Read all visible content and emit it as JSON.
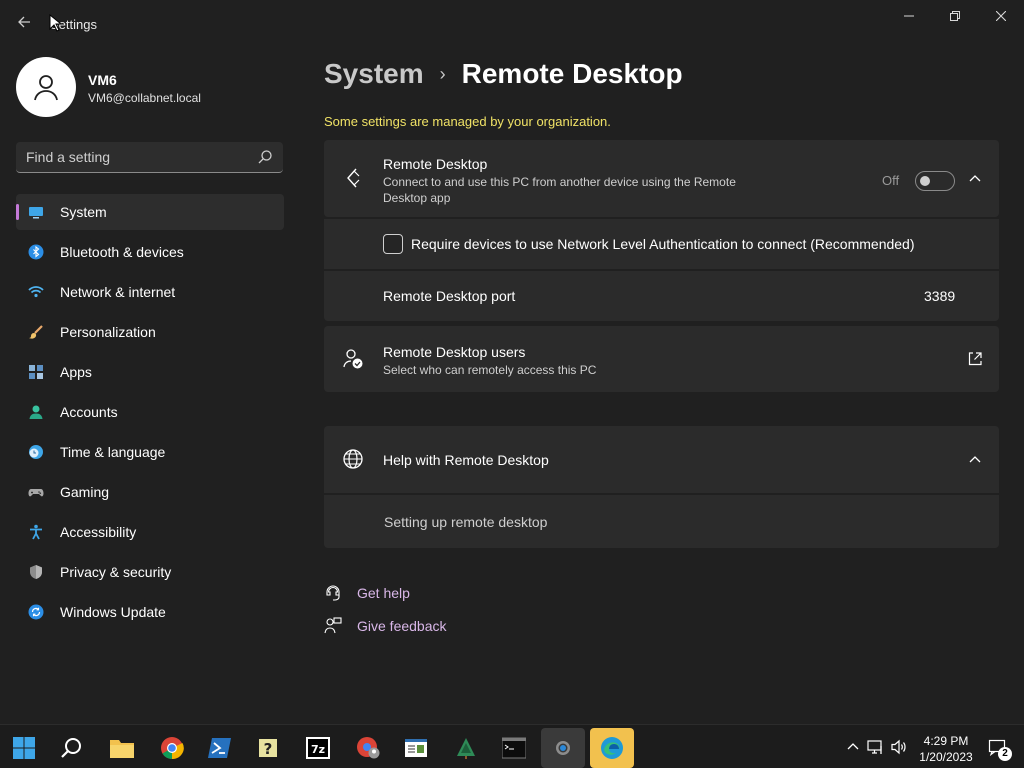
{
  "window": {
    "title": "Settings",
    "back_icon": "back-arrow-icon",
    "minimize_icon": "minimize-icon",
    "maximize_icon": "restore-icon",
    "close_icon": "close-icon"
  },
  "user": {
    "name": "VM6",
    "email": "VM6@collabnet.local",
    "avatar_icon": "person-icon"
  },
  "search": {
    "placeholder": "Find a setting",
    "icon": "search-icon"
  },
  "sidebar": {
    "accent_color": "#c479d8",
    "items": [
      {
        "label": "System",
        "icon": "monitor-icon",
        "active": true
      },
      {
        "label": "Bluetooth & devices",
        "icon": "bluetooth-icon",
        "active": false
      },
      {
        "label": "Network & internet",
        "icon": "wifi-icon",
        "active": false
      },
      {
        "label": "Personalization",
        "icon": "brush-icon",
        "active": false
      },
      {
        "label": "Apps",
        "icon": "apps-icon",
        "active": false
      },
      {
        "label": "Accounts",
        "icon": "account-icon",
        "active": false
      },
      {
        "label": "Time & language",
        "icon": "clock-globe-icon",
        "active": false
      },
      {
        "label": "Gaming",
        "icon": "gamepad-icon",
        "active": false
      },
      {
        "label": "Accessibility",
        "icon": "accessibility-icon",
        "active": false
      },
      {
        "label": "Privacy & security",
        "icon": "shield-icon",
        "active": false
      },
      {
        "label": "Windows Update",
        "icon": "update-icon",
        "active": false
      }
    ]
  },
  "main": {
    "breadcrumb_parent": "System",
    "breadcrumb_separator": "›",
    "page_title": "Remote Desktop",
    "managed_note": "Some settings are managed by your organization.",
    "managed_note_color": "#f0e266",
    "remote_desktop": {
      "title": "Remote Desktop",
      "description": "Connect to and use this PC from another device using the Remote Desktop app",
      "toggle_state": "Off",
      "toggle_on": false,
      "icon": "remote-desktop-icon",
      "chevron_icon": "chevron-up-icon"
    },
    "nla": {
      "label": "Require devices to use Network Level Authentication to connect (Recommended)",
      "checked": false
    },
    "port": {
      "label": "Remote Desktop port",
      "value": "3389"
    },
    "users": {
      "title": "Remote Desktop users",
      "description": "Select who can remotely access this PC",
      "icon": "users-check-icon",
      "open_icon": "external-link-icon"
    },
    "help": {
      "title": "Help with Remote Desktop",
      "icon": "globe-icon",
      "chevron_icon": "chevron-up-icon",
      "link": "Setting up remote desktop"
    },
    "footer": {
      "get_help": "Get help",
      "give_feedback": "Give feedback",
      "link_color": "#d9b7e8"
    }
  },
  "taskbar": {
    "apps": [
      {
        "name": "start-button",
        "icon": "windows-logo-icon",
        "active": false
      },
      {
        "name": "search-button",
        "icon": "search-icon",
        "active": false
      },
      {
        "name": "file-explorer",
        "icon": "folder-icon",
        "active": false
      },
      {
        "name": "chrome",
        "icon": "chrome-icon",
        "active": false
      },
      {
        "name": "powershell",
        "icon": "powershell-icon",
        "active": false
      },
      {
        "name": "help-app",
        "icon": "help-icon",
        "active": false
      },
      {
        "name": "7zip",
        "icon": "7zip-icon",
        "active": false
      },
      {
        "name": "chrome-profile",
        "icon": "chrome-user-icon",
        "active": false
      },
      {
        "name": "notepad-app",
        "icon": "document-window-icon",
        "active": false
      },
      {
        "name": "tree-app",
        "icon": "tree-icon",
        "active": false
      },
      {
        "name": "terminal",
        "icon": "terminal-icon",
        "active": false
      },
      {
        "name": "settings-app",
        "icon": "gear-icon",
        "active": true
      },
      {
        "name": "edge",
        "icon": "edge-icon",
        "active": false
      }
    ],
    "clock_time": "4:29 PM",
    "clock_date": "1/20/2023",
    "notification_count": "2"
  }
}
